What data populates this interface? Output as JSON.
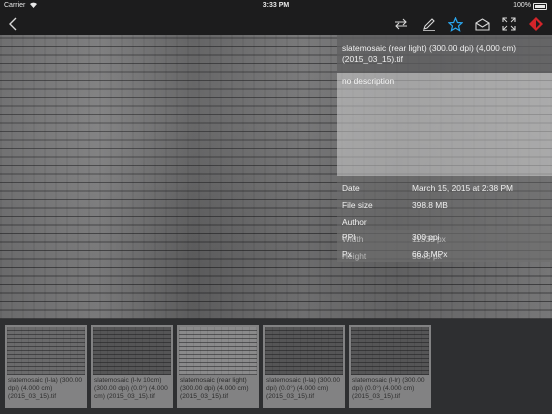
{
  "status": {
    "carrier": "Carrier",
    "wifi_icon": "wifi-icon",
    "time": "3:33 PM",
    "battery": "100%"
  },
  "nav": {
    "icons": [
      "back-chevron-icon",
      "transfer-arrows-icon",
      "pen-icon",
      "star-icon",
      "envelope-icon",
      "fullscreen-icon",
      "app-logo-icon"
    ],
    "accent": "#2aa7f0",
    "logo_red": "#d3242a"
  },
  "info": {
    "title": "slatemosaic (rear light) (300.00 dpi) (4,000 cm) (2015_03_15).tif",
    "description": "no description",
    "rows": [
      {
        "key": "Date",
        "value": "March 15, 2015 at 2:38 PM"
      },
      {
        "key": "File size",
        "value": "398.8 MB"
      },
      {
        "key": "Author",
        "value": ""
      },
      {
        "key": "Width",
        "value": "11339 px"
      },
      {
        "key": "Height",
        "value": "5846 px"
      },
      {
        "key": "PPI",
        "value": "300 ppi"
      },
      {
        "key": "Px",
        "value": "66.3 MPx"
      }
    ]
  },
  "thumbnails": [
    {
      "caption": "slatemosaic (l-la) (300.00 dpi) (4.000 cm) (2015_03_15).tif"
    },
    {
      "caption": "slatemosaic (l-lv 10cm) (300.00 dpi) (0.0°) (4.000 cm) (2015_03_15).tif"
    },
    {
      "caption": "slatemosaic (rear light) (300.00 dpi) (4.000 cm) (2015_03_15).tif"
    },
    {
      "caption": "slatemosaic (l-la) (300.00 dpi) (0.0°) (4.000 cm) (2015_03_15).tif"
    },
    {
      "caption": "slatemosaic (l-lr) (300.00 dpi) (0.0°) (4.000 cm) (2015_03_15).tif"
    }
  ]
}
